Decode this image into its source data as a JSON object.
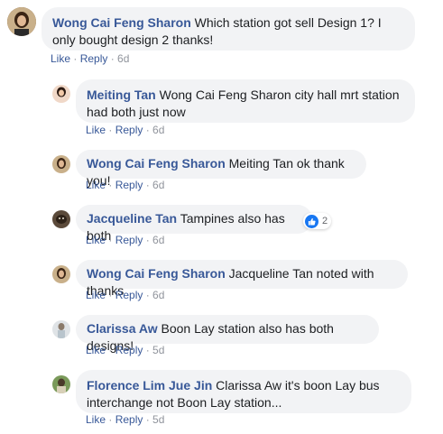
{
  "comments": [
    {
      "name": "Wong Cai Feng Sharon",
      "text": "Which station got sell Design 1? I only bought design 2 thanks!",
      "like": "Like",
      "reply": "Reply",
      "time": "6d"
    },
    {
      "name": "Meiting Tan",
      "text": "Wong Cai Feng Sharon city hall mrt station had both just now",
      "like": "Like",
      "reply": "Reply",
      "time": "6d"
    },
    {
      "name": "Wong Cai Feng Sharon",
      "text": "Meiting Tan ok thank you!",
      "like": "Like",
      "reply": "Reply",
      "time": "6d"
    },
    {
      "name": "Jacqueline Tan",
      "text": "Tampines also has both",
      "like": "Like",
      "reply": "Reply",
      "time": "6d",
      "reactions": "2"
    },
    {
      "name": "Wong Cai Feng Sharon",
      "text": "Jacqueline Tan noted with thanks",
      "like": "Like",
      "reply": "Reply",
      "time": "6d"
    },
    {
      "name": "Clarissa Aw",
      "text": "Boon Lay station also has both designs!",
      "like": "Like",
      "reply": "Reply",
      "time": "5d"
    },
    {
      "name": "Florence Lim Jue Jin",
      "text": "Clarissa Aw it's boon Lay bus interchange not Boon Lay station...",
      "like": "Like",
      "reply": "Reply",
      "time": "5d"
    }
  ],
  "colors": {
    "name": "#385898",
    "bubble": "#f2f3f5",
    "like_badge": "#1877f2"
  }
}
